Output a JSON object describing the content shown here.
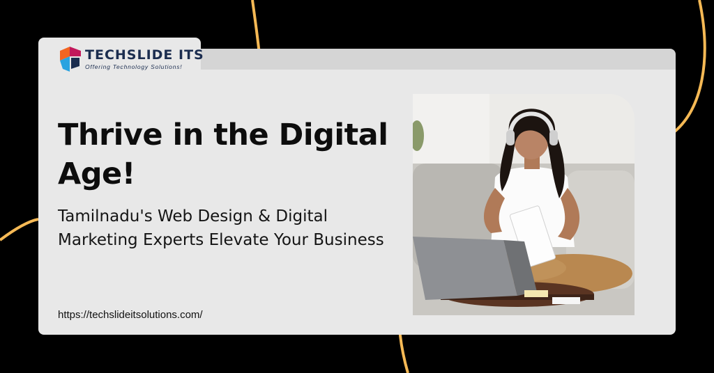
{
  "colors": {
    "background": "#000000",
    "card": "#e8e8e8",
    "accent_curve": "#f5b955",
    "brand_navy": "#1b2d4f",
    "brand_orange": "#f26522",
    "brand_blue": "#2aa3e0",
    "text": "#0d0d0d"
  },
  "logo": {
    "name": "TECHSLIDE ITS",
    "tagline": "Offering Technology Solutions!",
    "icon": "techslide-logo-mark"
  },
  "headline": "Thrive in the Digital Age!",
  "subheadline": "Tamilnadu's Web Design & Digital Marketing Experts Elevate Your Business",
  "url": "https://techslideitsolutions.com/",
  "photo": {
    "subject": "woman-with-headphones-laptop-notebook"
  }
}
